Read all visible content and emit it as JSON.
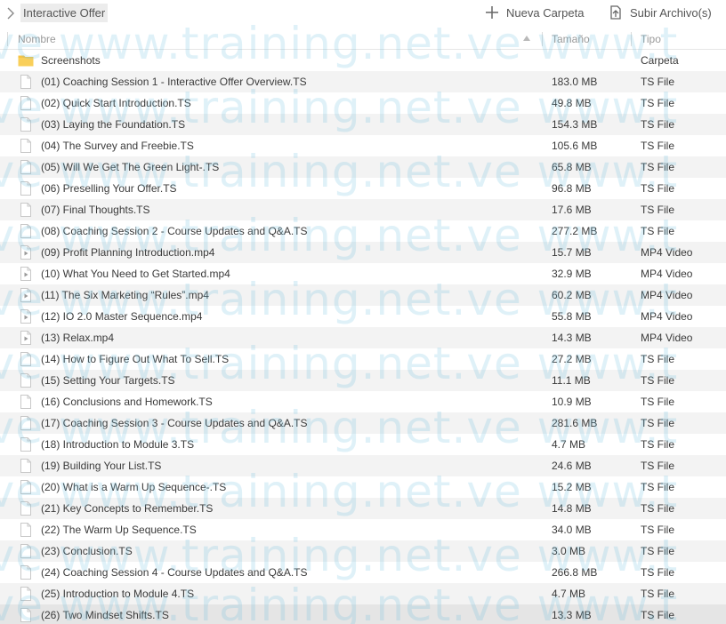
{
  "toolbar": {
    "breadcrumb": "Interactive Offer",
    "new_folder": "Nueva Carpeta",
    "upload": "Subir Archivo(s)"
  },
  "columns": {
    "name": "Nombre",
    "size": "Tamaño",
    "type": "Tipo"
  },
  "watermark": "elve www.training.net.ve www.t",
  "files": [
    {
      "name": "Screenshots",
      "size": "",
      "type": "Carpeta",
      "icon": "folder-icon"
    },
    {
      "name": "(01) Coaching Session 1 - Interactive Offer Overview.TS",
      "size": "183.0 MB",
      "type": "TS File",
      "icon": "file-icon"
    },
    {
      "name": "(02) Quick Start Introduction.TS",
      "size": "49.8 MB",
      "type": "TS File",
      "icon": "file-icon"
    },
    {
      "name": "(03) Laying the Foundation.TS",
      "size": "154.3 MB",
      "type": "TS File",
      "icon": "file-icon"
    },
    {
      "name": "(04) The Survey and Freebie.TS",
      "size": "105.6 MB",
      "type": "TS File",
      "icon": "file-icon"
    },
    {
      "name": "(05) Will We Get The Green Light-.TS",
      "size": "65.8 MB",
      "type": "TS File",
      "icon": "file-icon"
    },
    {
      "name": "(06) Preselling Your Offer.TS",
      "size": "96.8 MB",
      "type": "TS File",
      "icon": "file-icon"
    },
    {
      "name": "(07) Final Thoughts.TS",
      "size": "17.6 MB",
      "type": "TS File",
      "icon": "file-icon"
    },
    {
      "name": "(08) Coaching Session 2 - Course Updates and Q&A.TS",
      "size": "277.2 MB",
      "type": "TS File",
      "icon": "file-icon"
    },
    {
      "name": "(09) Profit Planning Introduction.mp4",
      "size": "15.7 MB",
      "type": "MP4 Video",
      "icon": "video-icon"
    },
    {
      "name": "(10) What You Need to Get Started.mp4",
      "size": "32.9 MB",
      "type": "MP4 Video",
      "icon": "video-icon"
    },
    {
      "name": "(11) The Six Marketing “Rules”.mp4",
      "size": "60.2 MB",
      "type": "MP4 Video",
      "icon": "video-icon"
    },
    {
      "name": "(12) IO 2.0 Master Sequence.mp4",
      "size": "55.8 MB",
      "type": "MP4 Video",
      "icon": "video-icon"
    },
    {
      "name": "(13) Relax.mp4",
      "size": "14.3 MB",
      "type": "MP4 Video",
      "icon": "video-icon"
    },
    {
      "name": "(14) How to Figure Out What To Sell.TS",
      "size": "27.2 MB",
      "type": "TS File",
      "icon": "file-icon"
    },
    {
      "name": "(15) Setting Your Targets.TS",
      "size": "11.1 MB",
      "type": "TS File",
      "icon": "file-icon"
    },
    {
      "name": "(16) Conclusions and Homework.TS",
      "size": "10.9 MB",
      "type": "TS File",
      "icon": "file-icon"
    },
    {
      "name": "(17) Coaching Session 3 - Course Updates and Q&A.TS",
      "size": "281.6 MB",
      "type": "TS File",
      "icon": "file-icon"
    },
    {
      "name": "(18) Introduction to Module 3.TS",
      "size": "4.7 MB",
      "type": "TS File",
      "icon": "file-icon"
    },
    {
      "name": "(19) Building Your List.TS",
      "size": "24.6 MB",
      "type": "TS File",
      "icon": "file-icon"
    },
    {
      "name": "(20) What is a Warm Up Sequence-.TS",
      "size": "15.2 MB",
      "type": "TS File",
      "icon": "file-icon"
    },
    {
      "name": "(21) Key Concepts to Remember.TS",
      "size": "14.8 MB",
      "type": "TS File",
      "icon": "file-icon"
    },
    {
      "name": "(22) The Warm Up Sequence.TS",
      "size": "34.0 MB",
      "type": "TS File",
      "icon": "file-icon"
    },
    {
      "name": "(23) Conclusion.TS",
      "size": "3.0 MB",
      "type": "TS File",
      "icon": "file-icon"
    },
    {
      "name": "(24) Coaching Session 4 - Course Updates and Q&A.TS",
      "size": "266.8 MB",
      "type": "TS File",
      "icon": "file-icon"
    },
    {
      "name": "(25) Introduction to Module 4.TS",
      "size": "4.7 MB",
      "type": "TS File",
      "icon": "file-icon"
    },
    {
      "name": "(26) Two Mindset Shifts.TS",
      "size": "13.3 MB",
      "type": "TS File",
      "icon": "file-icon"
    }
  ],
  "colors": {
    "text": "#3a3a3a",
    "muted": "#9a9a9a",
    "row_alt": "#f3f3f3",
    "row_selected": "#e5e5e5",
    "folder": "#f6c343",
    "watermark": "#6ebee1"
  }
}
